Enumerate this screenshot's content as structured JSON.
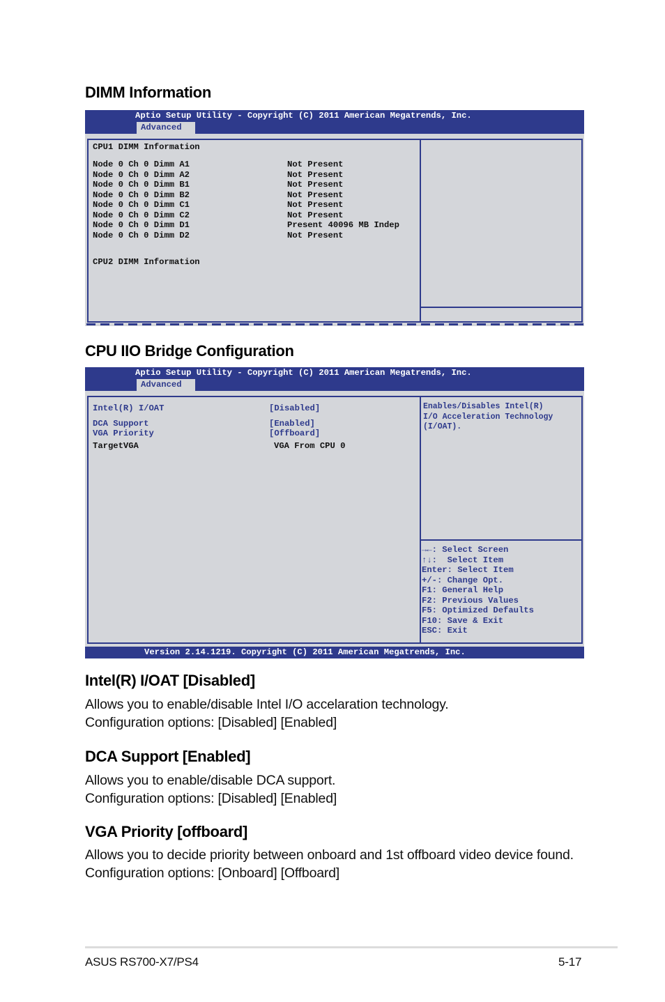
{
  "sections": {
    "dimm_title": "DIMM Information",
    "iio_title": "CPU IIO Bridge Configuration"
  },
  "bios_header": {
    "title": "Aptio Setup Utility - Copyright (C) 2011 American Megatrends, Inc.",
    "tab": "Advanced"
  },
  "dimm_screen": {
    "cpu1_heading": "CPU1 DIMM Information",
    "rows": [
      {
        "label": "Node 0 Ch 0 Dimm A1",
        "value": "Not Present"
      },
      {
        "label": "Node 0 Ch 0 Dimm A2",
        "value": "Not Present"
      },
      {
        "label": "Node 0 Ch 0 Dimm B1",
        "value": "Not Present"
      },
      {
        "label": "Node 0 Ch 0 Dimm B2",
        "value": "Not Present"
      },
      {
        "label": "Node 0 Ch 0 Dimm C1",
        "value": "Not Present"
      },
      {
        "label": "Node 0 Ch 0 Dimm C2",
        "value": "Not Present"
      },
      {
        "label": "Node 0 Ch 0 Dimm D1",
        "value": "Present 40096 MB Indep"
      },
      {
        "label": "Node 0 Ch 0 Dimm D2",
        "value": "Not Present"
      }
    ],
    "cpu2_heading": "CPU2 DIMM Information"
  },
  "iio_screen": {
    "items": [
      {
        "label": "Intel(R) I/OAT",
        "value": "[Disabled]"
      },
      {
        "label": "DCA Support",
        "value": "[Enabled]"
      },
      {
        "label": "VGA Priority",
        "value": "[Offboard]"
      },
      {
        "label": "TargetVGA",
        "value": "VGA From CPU 0"
      }
    ],
    "help_lines": [
      "Enables/Disables Intel(R)",
      "I/O Acceleration Technology",
      "(I/OAT)."
    ],
    "keys": [
      "→←: Select Screen",
      "↑↓:  Select Item",
      "Enter: Select Item",
      "+/-: Change Opt.",
      "F1: General Help",
      "F2: Previous Values",
      "F5: Optimized Defaults",
      "F10: Save & Exit",
      "ESC: Exit"
    ],
    "footer": "Version 2.14.1219. Copyright (C) 2011 American Megatrends, Inc."
  },
  "descriptions": [
    {
      "title": "Intel(R) I/OAT [Disabled]",
      "line1": "Allows you to enable/disable Intel I/O accelaration technology.",
      "line2": "Configuration options: [Disabled] [Enabled]"
    },
    {
      "title": "DCA Support [Enabled]",
      "line1": "Allows you to enable/disable DCA support.",
      "line2": "Configuration options: [Disabled] [Enabled]"
    },
    {
      "title": "VGA Priority [offboard]",
      "line1": "Allows you to decide priority between onboard and 1st offboard video device found.",
      "line2": "Configuration options: [Onboard] [Offboard]"
    }
  ],
  "page_footer": {
    "product": "ASUS RS700-X7/PS4",
    "page": "5-17"
  },
  "colors": {
    "bios_blue": "#2e3a8c",
    "bios_gray": "#d4d6da"
  }
}
